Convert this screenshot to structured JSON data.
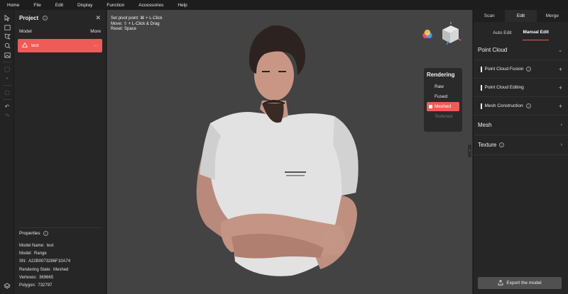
{
  "menu": [
    "Home",
    "File",
    "Edit",
    "Display",
    "Function",
    "Accessories",
    "Help"
  ],
  "project": {
    "title": "Project",
    "model_label": "Model",
    "more_label": "More",
    "model_item": "test",
    "model_item_menu": "···"
  },
  "properties": {
    "title": "Properties",
    "rows": [
      {
        "label": "Model Name:",
        "value": "test"
      },
      {
        "label": "Model:",
        "value": "Range"
      },
      {
        "label": "SN:",
        "value": "A22B0073286F10A74"
      },
      {
        "label": "Rendering State:",
        "value": "Meshed"
      },
      {
        "label": "Vertexes:",
        "value": "369665"
      },
      {
        "label": "Polygon:",
        "value": "732797"
      }
    ]
  },
  "hints": {
    "pivot": "Set pivot point: ⌘ + L-Click",
    "move": "Move: ⇧ + L-Click & Drag",
    "reset": "Reset: Space"
  },
  "rendering": {
    "title": "Rendering",
    "options": [
      "Raw",
      "Fused",
      "Meshed",
      "Textured"
    ],
    "selected": "Meshed"
  },
  "right_panel": {
    "tabs": [
      "Scan",
      "Edit",
      "Merge"
    ],
    "active_tab": "Edit",
    "subtabs": [
      "Auto Edit",
      "Manual Edit"
    ],
    "active_subtab": "Manual Edit",
    "point_cloud": {
      "title": "Point Cloud",
      "items": [
        "Point Cloud Fusion",
        "Point Cloud Editing",
        "Mesh Construction"
      ]
    },
    "mesh_title": "Mesh",
    "texture_title": "Texture",
    "export_label": "Export the model"
  },
  "colors": {
    "accent": "#ef5b57",
    "viewport_bg": "#434343",
    "panel_bg": "#262626"
  }
}
